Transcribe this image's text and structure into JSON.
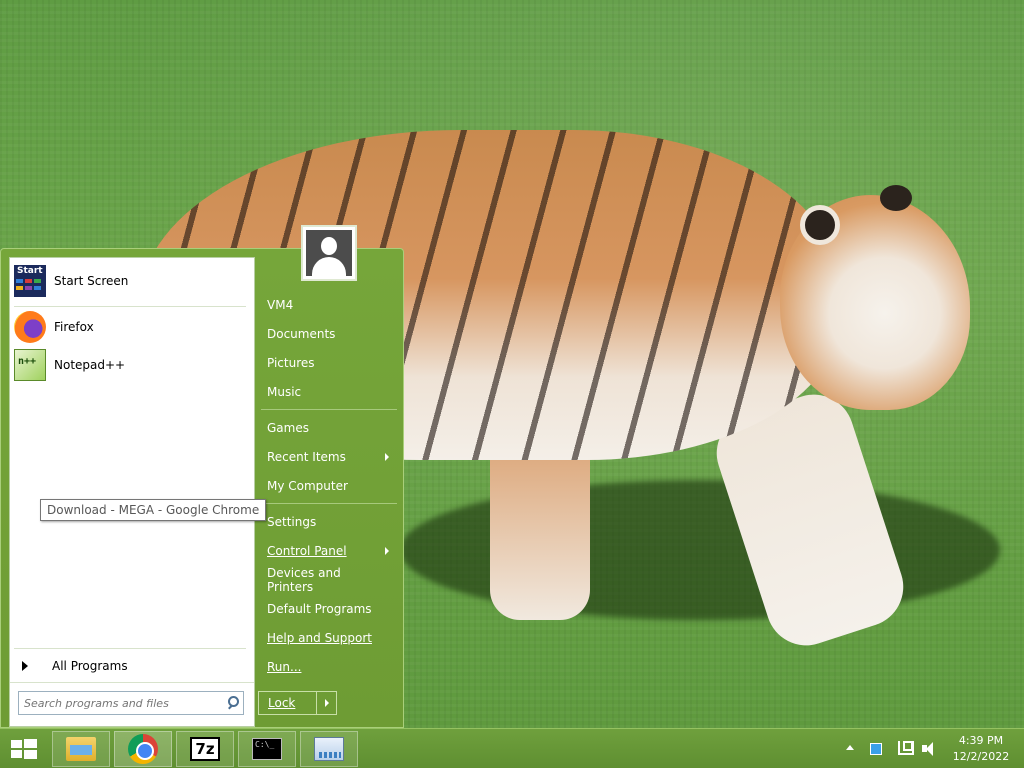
{
  "desktop": {
    "wallpaper": "tiger-on-grass"
  },
  "start_menu": {
    "pinned": [
      {
        "label": "Start Screen",
        "icon": "start-screen-icon"
      },
      {
        "label": "Firefox",
        "icon": "firefox-icon"
      },
      {
        "label": "Notepad++",
        "icon": "notepadpp-icon"
      }
    ],
    "start_screen_icon_text": "Start",
    "all_programs": "All Programs",
    "search_placeholder": "Search programs and files",
    "right_items": [
      {
        "label": "VM4"
      },
      {
        "label": "Documents"
      },
      {
        "label": "Pictures"
      },
      {
        "label": "Music"
      },
      {
        "label": "Games"
      },
      {
        "label": "Recent Items",
        "submenu": true
      },
      {
        "label": "My Computer"
      },
      {
        "label": "Settings"
      },
      {
        "label": "Control Panel",
        "submenu": true
      },
      {
        "label": "Devices and Printers"
      },
      {
        "label": "Default Programs"
      },
      {
        "label": "Help and Support"
      },
      {
        "label": "Run..."
      }
    ],
    "lock_button": "Lock",
    "accent": "#76a63a"
  },
  "tooltip": {
    "text": "Download - MEGA - Google Chrome"
  },
  "taskbar": {
    "buttons": [
      {
        "name": "file-explorer",
        "icon": "folder-icon"
      },
      {
        "name": "google-chrome",
        "icon": "chrome-icon",
        "active": true
      },
      {
        "name": "7-zip",
        "icon": "7z-icon",
        "text": "7z"
      },
      {
        "name": "command-prompt",
        "icon": "cmd-icon",
        "text": "C:\\_"
      },
      {
        "name": "resource-monitor",
        "icon": "monitor-icon"
      }
    ],
    "clock": {
      "time": "4:39 PM",
      "date": "12/2/2022"
    }
  }
}
